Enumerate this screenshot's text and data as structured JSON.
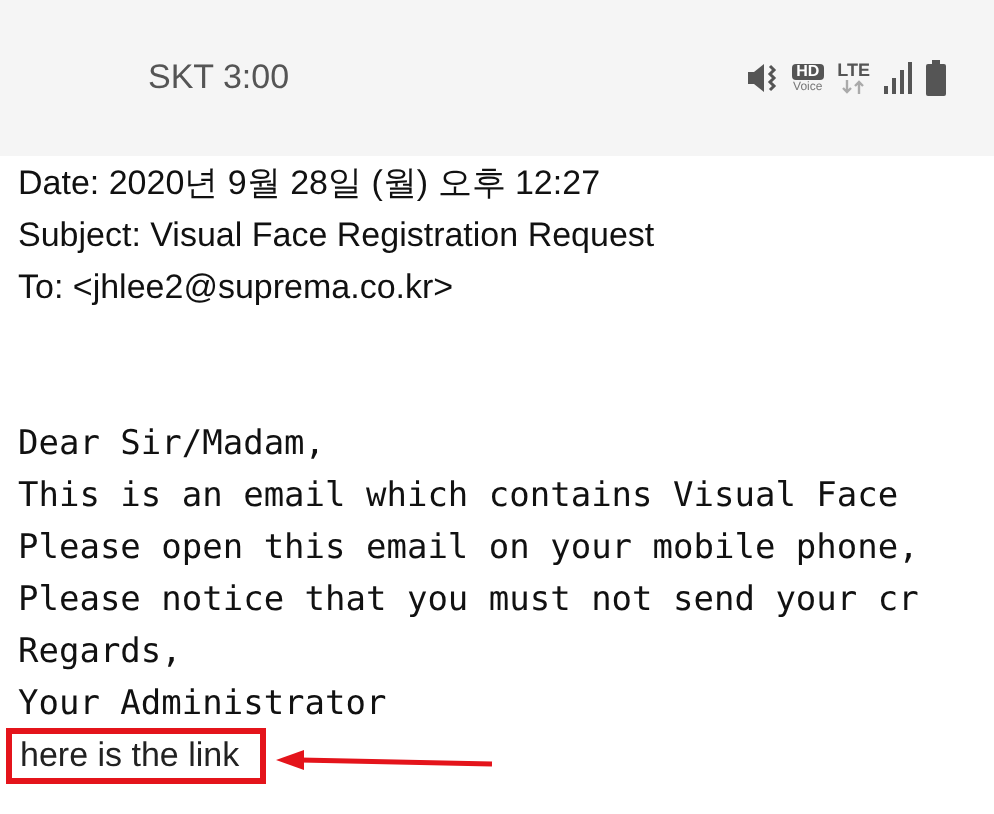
{
  "status_bar": {
    "carrier_time": "SKT 3:00",
    "hd_badge": "HD",
    "voice_label": "Voice",
    "network_label": "LTE"
  },
  "email": {
    "headers": [
      "Date: 2020년 9월 28일 (월) 오후 12:27",
      "Subject: Visual Face Registration Request",
      "To: <jhlee2@suprema.co.kr>"
    ],
    "body_lines": [
      "Dear Sir/Madam,",
      "This is an email which contains Visual Face",
      "Please open this email on your mobile phone,",
      "Please notice that you must not send your cr",
      "Regards,",
      "Your Administrator"
    ],
    "link_text": "here is the link"
  }
}
